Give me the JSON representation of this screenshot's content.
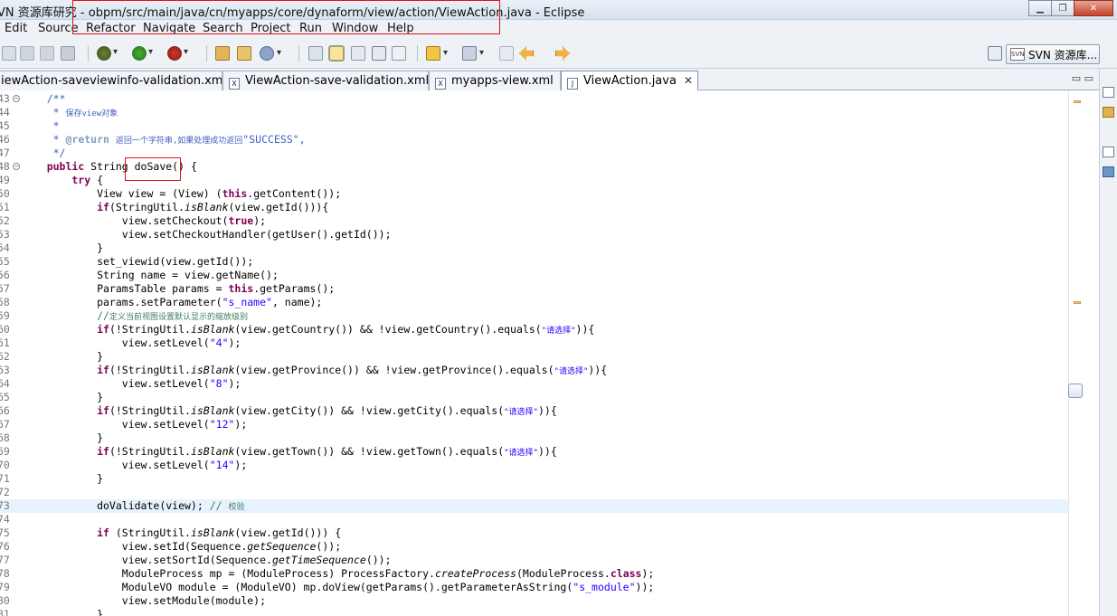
{
  "window": {
    "title_prefix": "VN 资源库研究",
    "title_separator": " - ",
    "title_path": "obpm/src/main/java/cn/myapps/core/dynaform/view/action/ViewAction.java - Eclipse",
    "buttons": {
      "minimize": "▁",
      "maximize": "❐",
      "close": "✕"
    }
  },
  "menu": {
    "items": [
      "Edit",
      "Source",
      "Refactor",
      "Navigate",
      "Search",
      "Project",
      "Run",
      "Window",
      "Help"
    ]
  },
  "perspective": {
    "label": "SVN 资源库..."
  },
  "tabs": [
    {
      "label": "iewAction-saveviewinfo-validation.xml",
      "active": false
    },
    {
      "label": "ViewAction-save-validation.xml",
      "active": false
    },
    {
      "label": "myapps-view.xml",
      "active": false
    },
    {
      "label": "ViewAction.java",
      "active": true
    }
  ],
  "tab_controls": "▭ ▭",
  "editor": {
    "lines": [
      {
        "n": "43",
        "fold": true
      },
      {
        "n": "44"
      },
      {
        "n": "45"
      },
      {
        "n": "46"
      },
      {
        "n": "47"
      },
      {
        "n": "48",
        "fold": true
      },
      {
        "n": "49"
      },
      {
        "n": "50"
      },
      {
        "n": "51"
      },
      {
        "n": "52"
      },
      {
        "n": "53"
      },
      {
        "n": "54"
      },
      {
        "n": "55"
      },
      {
        "n": "56"
      },
      {
        "n": "57"
      },
      {
        "n": "58"
      },
      {
        "n": "59"
      },
      {
        "n": "60"
      },
      {
        "n": "61"
      },
      {
        "n": "62"
      },
      {
        "n": "63"
      },
      {
        "n": "64"
      },
      {
        "n": "65"
      },
      {
        "n": "66"
      },
      {
        "n": "67"
      },
      {
        "n": "68"
      },
      {
        "n": "69"
      },
      {
        "n": "70"
      },
      {
        "n": "71"
      },
      {
        "n": "72"
      },
      {
        "n": "73"
      },
      {
        "n": "74"
      },
      {
        "n": "75"
      },
      {
        "n": "76"
      },
      {
        "n": "77"
      },
      {
        "n": "78"
      },
      {
        "n": "79"
      },
      {
        "n": "80"
      },
      {
        "n": "81"
      }
    ],
    "highlighted_line": "73",
    "tokens": {
      "l43": "    /**",
      "l44a": "     * ",
      "l44b": "保存view对象",
      "l45": "     *",
      "l46a": "     * ",
      "l46tag": "@return",
      "l46b": " ",
      "l46c": "返回一个字符串,如果处理成功返回",
      "l46d": "\"SUCCESS\",",
      "l47": "     */",
      "l48a": "    public",
      "l48b": " String doSave() {",
      "l49a": "        try",
      "l49b": " {",
      "l50a": "            View view = (View) (",
      "l50b": "this",
      "l50c": ".getContent());",
      "l51a": "            if",
      "l51b": "(StringUtil.",
      "l51c": "isBlank",
      "l51d": "(view.getId())){",
      "l52a": "                view.setCheckout(",
      "l52b": "true",
      "l52c": ");",
      "l53": "                view.setCheckoutHandler(getUser().getId());",
      "l54": "            }",
      "l55": "            set_viewid(view.getId());",
      "l56": "            String name = view.getName();",
      "l57a": "            ParamsTable params = ",
      "l57b": "this",
      "l57c": ".getParams();",
      "l58a": "            params.setParameter(",
      "l58b": "\"s_name\"",
      "l58c": ", name);",
      "l59a": "            //",
      "l59b": "定义当前视图设置默认显示的缩放级别",
      "l60a": "            if",
      "l60b": "(!StringUtil.",
      "l60c": "isBlank",
      "l60d": "(view.getCountry()) && !view.getCountry().equals(",
      "l60e": "\"请选择\"",
      "l60f": ")){",
      "l61a": "                view.setLevel(",
      "l61b": "\"4\"",
      "l61c": ");",
      "l62": "            }",
      "l63a": "            if",
      "l63b": "(!StringUtil.",
      "l63c": "isBlank",
      "l63d": "(view.getProvince()) && !view.getProvince().equals(",
      "l63e": "\"请选择\"",
      "l63f": ")){",
      "l64a": "                view.setLevel(",
      "l64b": "\"8\"",
      "l64c": ");",
      "l65": "            }",
      "l66a": "            if",
      "l66b": "(!StringUtil.",
      "l66c": "isBlank",
      "l66d": "(view.getCity()) && !view.getCity().equals(",
      "l66e": "\"请选择\"",
      "l66f": ")){",
      "l67a": "                view.setLevel(",
      "l67b": "\"12\"",
      "l67c": ");",
      "l68": "            }",
      "l69a": "            if",
      "l69b": "(!StringUtil.",
      "l69c": "isBlank",
      "l69d": "(view.getTown()) && !view.getTown().equals(",
      "l69e": "\"请选择\"",
      "l69f": ")){",
      "l70a": "                view.setLevel(",
      "l70b": "\"14\"",
      "l70c": ");",
      "l71": "            }",
      "l72": "",
      "l73a": "            doValidate(view); ",
      "l73b": "// ",
      "l73c": "校验",
      "l74": "",
      "l75a": "            if",
      "l75b": " (StringUtil.",
      "l75c": "isBlank",
      "l75d": "(view.getId())) {",
      "l76a": "                view.setId(Sequence.",
      "l76b": "getSequence",
      "l76c": "());",
      "l77a": "                view.setSortId(Sequence.",
      "l77b": "getTimeSequence",
      "l77c": "());",
      "l78a": "                ModuleProcess mp = (ModuleProcess) ProcessFactory.",
      "l78b": "createProcess",
      "l78c": "(ModuleProcess.",
      "l78d": "class",
      "l78e": ");",
      "l79a": "                ModuleVO module = (ModuleVO) mp.doView(getParams().getParameterAsString(",
      "l79b": "\"s_module\"",
      "l79c": "));",
      "l80": "                view.setModule(module);",
      "l81": "            }"
    }
  },
  "colors": {
    "keyword": "#7f0055",
    "string": "#2a00ff",
    "comment": "#3f7f5f",
    "javadoc": "#3f5fbf",
    "annotation_box": "#dd1111"
  }
}
